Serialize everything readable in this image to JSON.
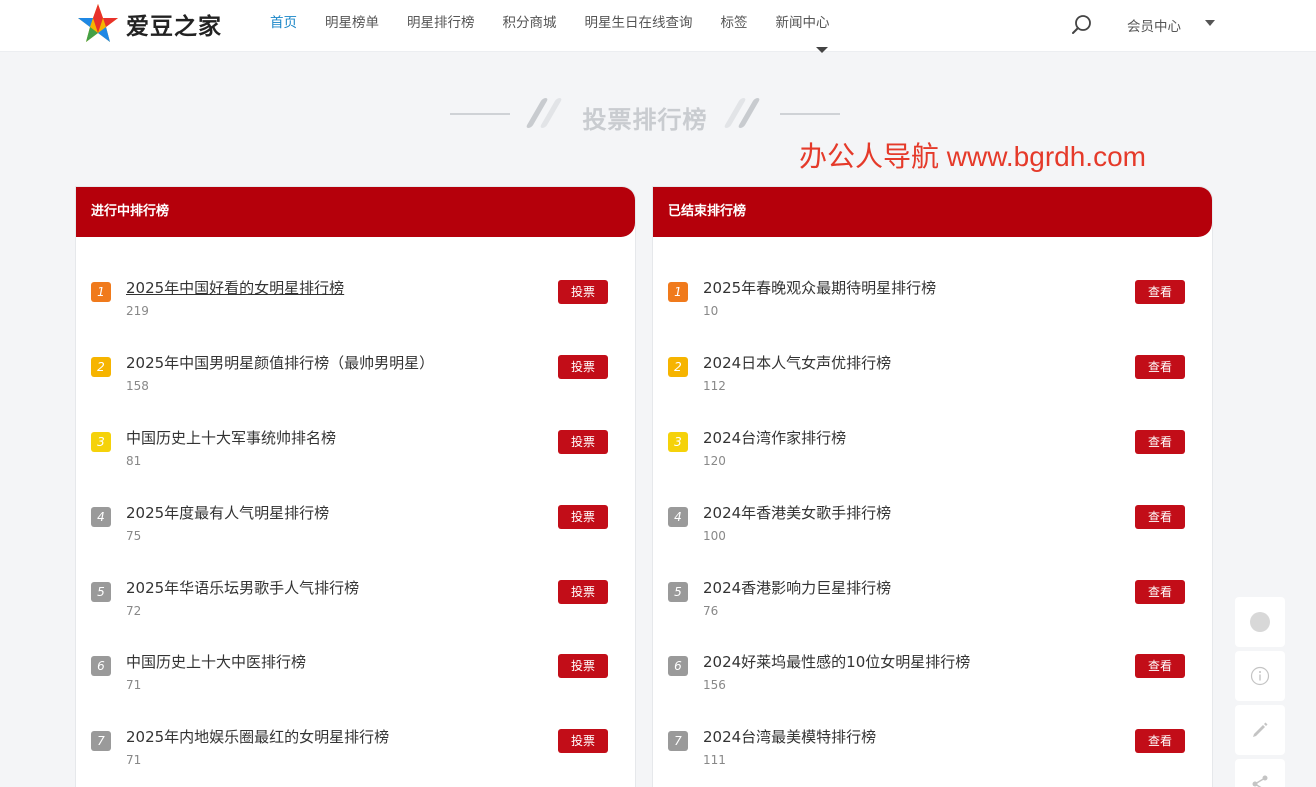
{
  "brand": {
    "name": "爱豆之家"
  },
  "nav": {
    "items": [
      "首页",
      "明星榜单",
      "明星排行榜",
      "积分商城",
      "明星生日在线查询",
      "标签",
      "新闻中心"
    ],
    "active_index": 0,
    "member_label": "会员中心"
  },
  "section": {
    "title": "投票排行榜"
  },
  "watermark": "办公人导航  www.bgrdh.com",
  "ongoing": {
    "header": "进行中排行榜",
    "action_label": "投票",
    "items": [
      {
        "rank": "1",
        "title": "2025年中国好看的女明星排行榜",
        "count": "219"
      },
      {
        "rank": "2",
        "title": "2025年中国男明星颜值排行榜（最帅男明星）",
        "count": "158"
      },
      {
        "rank": "3",
        "title": "中国历史上十大军事统帅排名榜",
        "count": "81"
      },
      {
        "rank": "4",
        "title": "2025年度最有人气明星排行榜",
        "count": "75"
      },
      {
        "rank": "5",
        "title": "2025年华语乐坛男歌手人气排行榜",
        "count": "72"
      },
      {
        "rank": "6",
        "title": "中国历史上十大中医排行榜",
        "count": "71"
      },
      {
        "rank": "7",
        "title": "2025年内地娱乐圈最红的女明星排行榜",
        "count": "71"
      }
    ]
  },
  "ended": {
    "header": "已结束排行榜",
    "action_label": "查看",
    "items": [
      {
        "rank": "1",
        "title": "2025年春晚观众最期待明星排行榜",
        "count": "10"
      },
      {
        "rank": "2",
        "title": "2024日本人气女声优排行榜",
        "count": "112"
      },
      {
        "rank": "3",
        "title": "2024台湾作家排行榜",
        "count": "120"
      },
      {
        "rank": "4",
        "title": "2024年香港美女歌手排行榜",
        "count": "100"
      },
      {
        "rank": "5",
        "title": "2024香港影响力巨星排行榜",
        "count": "76"
      },
      {
        "rank": "6",
        "title": "2024好莱坞最性感的10位女明星排行榜",
        "count": "156"
      },
      {
        "rank": "7",
        "title": "2024台湾最美模特排行榜",
        "count": "111"
      }
    ]
  },
  "side_tools": [
    "avatar-dot",
    "info-icon",
    "edit-icon",
    "share-icon"
  ],
  "colors": {
    "primary_red": "#b5000b",
    "button_red": "#c20d18",
    "nav_active": "#1a86c7",
    "watermark_red": "#e53a2a"
  }
}
